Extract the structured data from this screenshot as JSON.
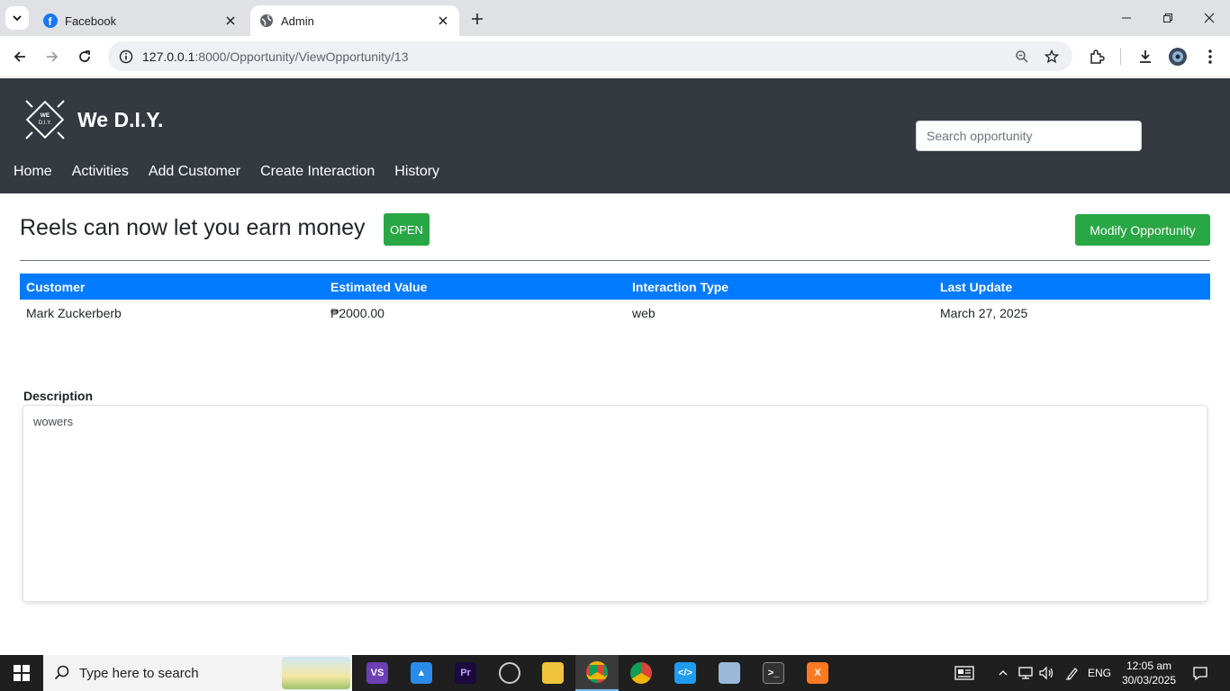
{
  "browser": {
    "tabs": [
      {
        "title": "Facebook",
        "icon": "facebook-icon"
      },
      {
        "title": "Admin",
        "icon": "globe-icon"
      }
    ],
    "url_host": "127.0.0.1",
    "url_path": ":8000/Opportunity/ViewOpportunity/13"
  },
  "app": {
    "logo_text_top": "WE",
    "logo_text_bottom": "D.I.Y.",
    "brand": "We D.I.Y.",
    "search_placeholder": "Search opportunity",
    "nav": [
      "Home",
      "Activities",
      "Add Customer",
      "Create Interaction",
      "History"
    ]
  },
  "opportunity": {
    "title": "Reels can now let you earn money",
    "status": "OPEN",
    "modify_label": "Modify Opportunity",
    "table": {
      "headers": [
        "Customer",
        "Estimated Value",
        "Interaction Type",
        "Last Update"
      ],
      "row": [
        "Mark Zuckerberb",
        "₱2000.00",
        "web",
        "March 27, 2025"
      ]
    },
    "description_label": "Description",
    "description": "wowers"
  },
  "taskbar": {
    "search_placeholder": "Type here to search",
    "language": "ENG",
    "time": "12:05 am",
    "date": "30/03/2025"
  },
  "colors": {
    "header_bg": "#343a40",
    "primary": "#007bff",
    "success": "#28a745"
  }
}
